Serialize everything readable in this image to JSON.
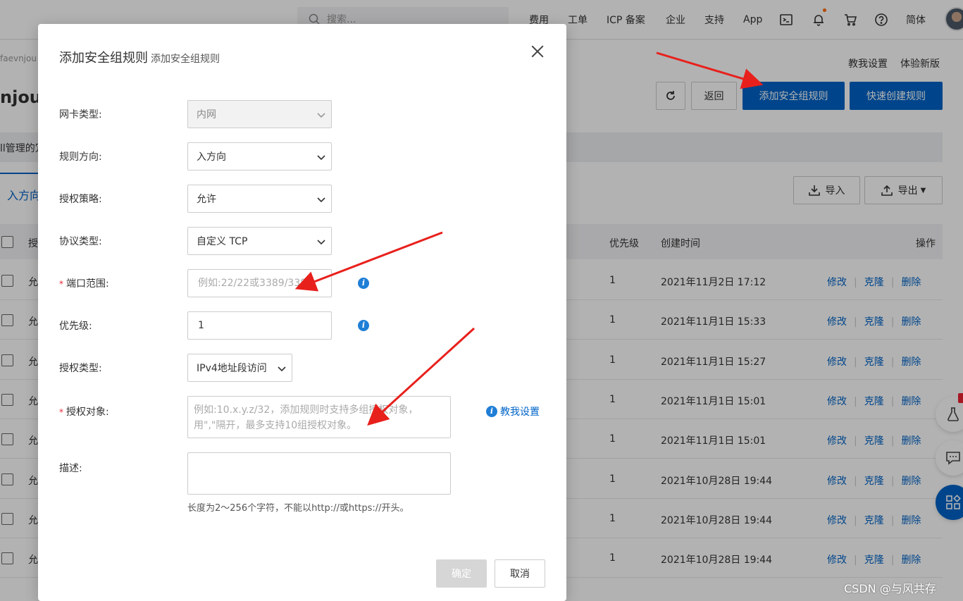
{
  "topbar": {
    "search_placeholder": "搜索...",
    "nav": [
      "费用",
      "工单",
      "ICP 备案",
      "企业",
      "支持",
      "App"
    ],
    "lang": "简体"
  },
  "page": {
    "breadcrumb_fragment": "faevnjou",
    "title_fragment": "njou",
    "links": {
      "help": "教我设置",
      "new_version": "体验新版"
    },
    "buttons": {
      "back": "返回",
      "add_rule": "添加安全组规则",
      "quick_create": "快速创建规则",
      "import": "导入",
      "export": "导出"
    },
    "notice_fragment": "ll管理的冗",
    "tab_inbound": "入方向",
    "table": {
      "headers": {
        "auth_fragment": "授",
        "priority": "优先级",
        "created": "创建时间",
        "actions": "操作"
      },
      "rows": [
        {
          "policy": "允",
          "priority": "1",
          "created": "2021年11月2日 17:12"
        },
        {
          "policy": "允",
          "priority": "1",
          "created": "2021年11月1日 15:33"
        },
        {
          "policy": "允",
          "priority": "1",
          "created": "2021年11月1日 15:27"
        },
        {
          "policy": "允",
          "priority": "1",
          "created": "2021年11月1日 15:01"
        },
        {
          "policy": "允",
          "priority": "1",
          "created": "2021年11月1日 15:01"
        },
        {
          "policy": "允",
          "priority": "1",
          "created": "2021年10月28日 19:44"
        },
        {
          "policy": "允",
          "priority": "1",
          "created": "2021年10月28日 19:44"
        },
        {
          "policy": "允",
          "priority": "1",
          "created": "2021年10月28日 19:44"
        }
      ],
      "actions": {
        "edit": "修改",
        "clone": "克隆",
        "delete": "删除"
      }
    }
  },
  "modal": {
    "title": "添加安全组规则",
    "subtitle": "添加安全组规则",
    "fields": {
      "nic_type": {
        "label": "网卡类型:",
        "value": "内网"
      },
      "direction": {
        "label": "规则方向:",
        "value": "入方向"
      },
      "policy": {
        "label": "授权策略:",
        "value": "允许"
      },
      "protocol": {
        "label": "协议类型:",
        "value": "自定义 TCP"
      },
      "port_range": {
        "label": "端口范围:",
        "placeholder": "例如:22/22或3389/3389"
      },
      "priority": {
        "label": "优先级:",
        "value": "1"
      },
      "auth_type": {
        "label": "授权类型:",
        "value": "IPv4地址段访问"
      },
      "auth_object": {
        "label": "授权对象:",
        "placeholder": "例如:10.x.y.z/32，添加规则时支持多组授权对象，用\",\"隔开，最多支持10组授权对象。"
      },
      "description": {
        "label": "描述:",
        "hint": "长度为2～256个字符，不能以http://或https://开头。"
      }
    },
    "required_mark": "*",
    "help_link": "教我设置",
    "buttons": {
      "ok": "确定",
      "cancel": "取消"
    }
  },
  "watermark": "CSDN @与风共存",
  "colors": {
    "primary": "#0064c8",
    "annotation_arrow": "#e8201c"
  }
}
